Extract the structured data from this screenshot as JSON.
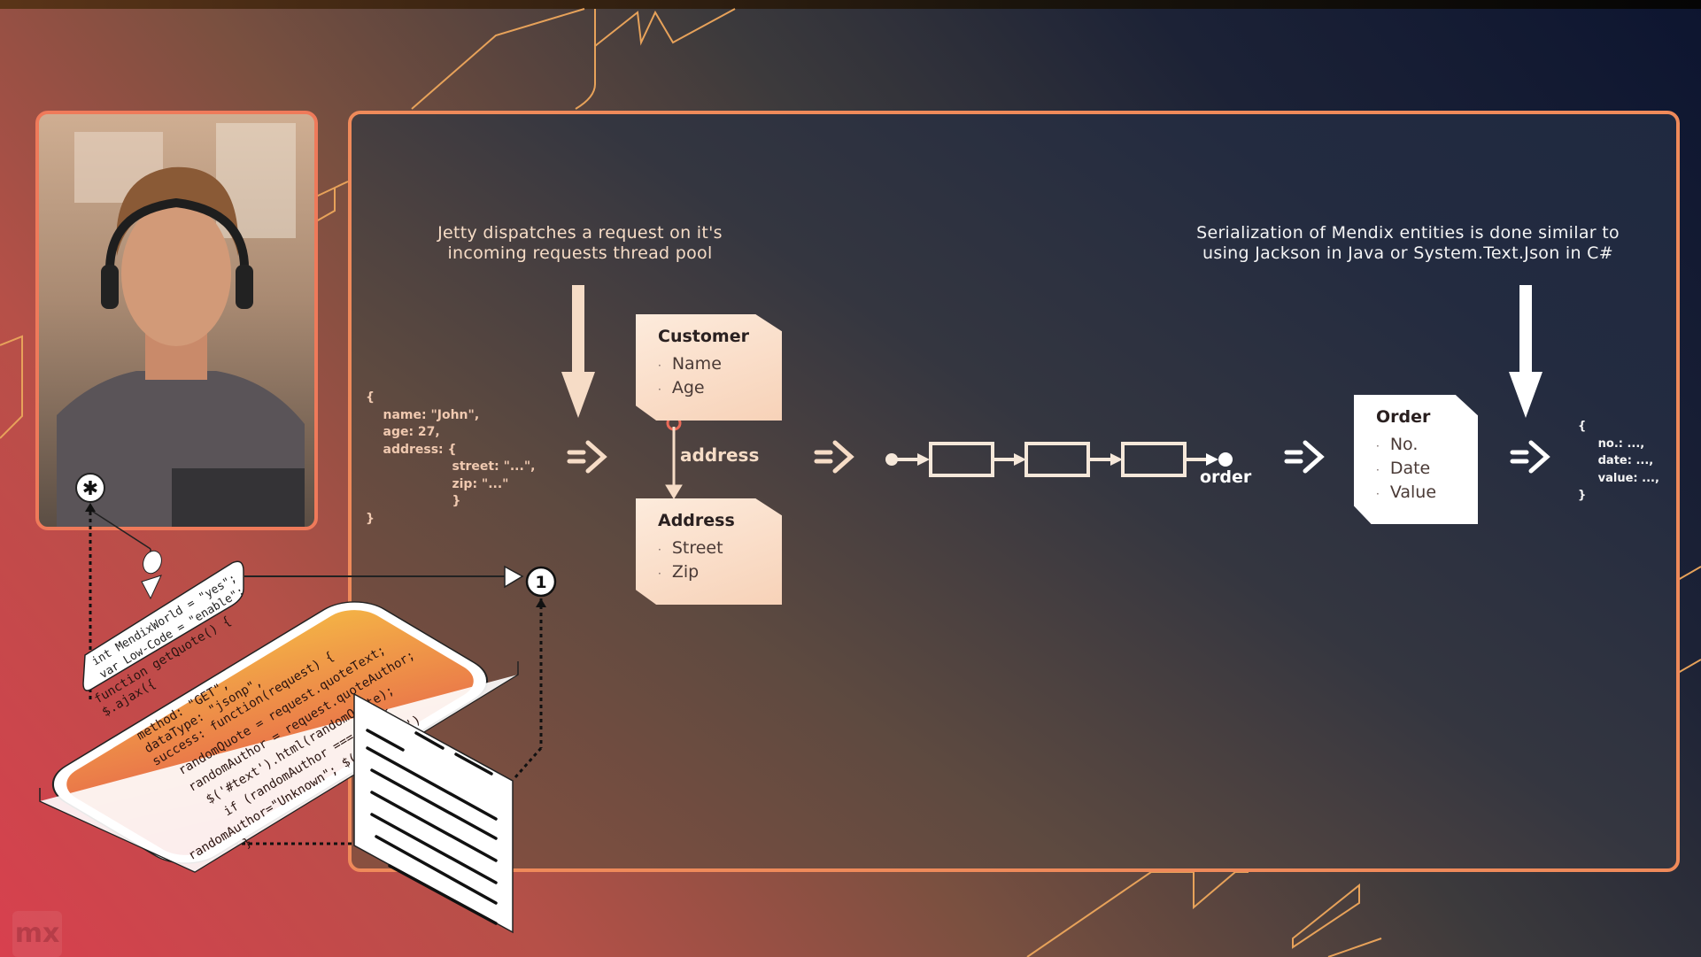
{
  "colors": {
    "accent_orange": "#ef8a5a",
    "entity_shadow": "#ea6a58",
    "caption": "#f6dcc6"
  },
  "left_note": {
    "caption": "Jetty dispatches a request on it's\nincoming requests thread pool",
    "json": "{\n    name: \"John\",\n    age: 27,\n    address: {\n                    street: \"...\",\n                    zip: \"...\"\n                    }\n}"
  },
  "customer": {
    "title": "Customer",
    "attrs": [
      "Name",
      "Age"
    ]
  },
  "association_label": "address",
  "address": {
    "title": "Address",
    "attrs": [
      "Street",
      "Zip"
    ]
  },
  "chain": {
    "end_label": "order",
    "steps": 3
  },
  "order": {
    "title": "Order",
    "attrs": [
      "No.",
      "Date",
      "Value"
    ]
  },
  "right_note": {
    "caption": "Serialization of Mendix entities is done similar to\nusing Jackson in Java or System.Text.Json in C#",
    "json": "{\n     no.: ...,\n     date: ...,\n     value: ...,\n}"
  },
  "phone": {
    "bubble": [
      "int MendixWorld = \"yes\";",
      "var Low-Code = \"enable\";"
    ],
    "code": [
      "function getQuote() {",
      "  $.ajax({",
      "    method: \"GET\",",
      "    dataType: \"jsonp\",",
      "    success: function(request) {",
      "      randomQuote = request.quoteText;",
      "      randomAuthor = request.quoteAuthor;",
      "      $('#text').html(randomQuote);",
      "        if (randomAuthor === \"\") {",
      "randomAuthor=\"Unknown\";  $('#author')",
      "      }"
    ]
  },
  "step_badge": "1",
  "logo": "mx",
  "icons": [
    "webcam-feed",
    "gear-icon",
    "arrow-down",
    "double-arrow-right",
    "play-triangle"
  ]
}
